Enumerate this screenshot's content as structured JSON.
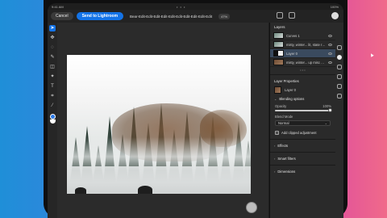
{
  "statusbar": {
    "time": "9:41 AM",
    "dots": "• • •",
    "right": "100%"
  },
  "topbar": {
    "cancel": "Cancel",
    "send": "Send to Lightroom",
    "title": "Bear-Edit-Edit-Edit-Edit-Edit-Edit-Edit-Edit-Edit-Edit",
    "zoom": "47%"
  },
  "layers": {
    "title": "Layers",
    "items": [
      {
        "name": "Curves 1",
        "thumb": "fog"
      },
      {
        "name": "misty, winter... lit, state row",
        "thumb": "fog"
      },
      {
        "name": "Layer 0",
        "thumb": "mask"
      },
      {
        "name": "misty, winter... up misc style",
        "thumb": "bear"
      }
    ],
    "more": "• • •"
  },
  "properties": {
    "title": "Layer Properties",
    "layer_name": "Layer 0",
    "blending_title": "Blending options",
    "opacity_label": "Opacity",
    "opacity_value": "100%",
    "opacity": 1.0,
    "blend_mode_label": "Blend Mode",
    "blend_mode": "Normal",
    "add_clipped": "Add clipped adjustment",
    "effects": "Effects",
    "smart_filters": "Smart filters",
    "dimensions": "Dimensions"
  },
  "tools": [
    "select",
    "move",
    "lasso",
    "brush",
    "eraser",
    "clone",
    "type",
    "crop",
    "eyedropper",
    "fill"
  ],
  "colors": {
    "accent": "#1473e6",
    "panel": "#2a2a2a",
    "canvas": "#2b2b2b"
  }
}
